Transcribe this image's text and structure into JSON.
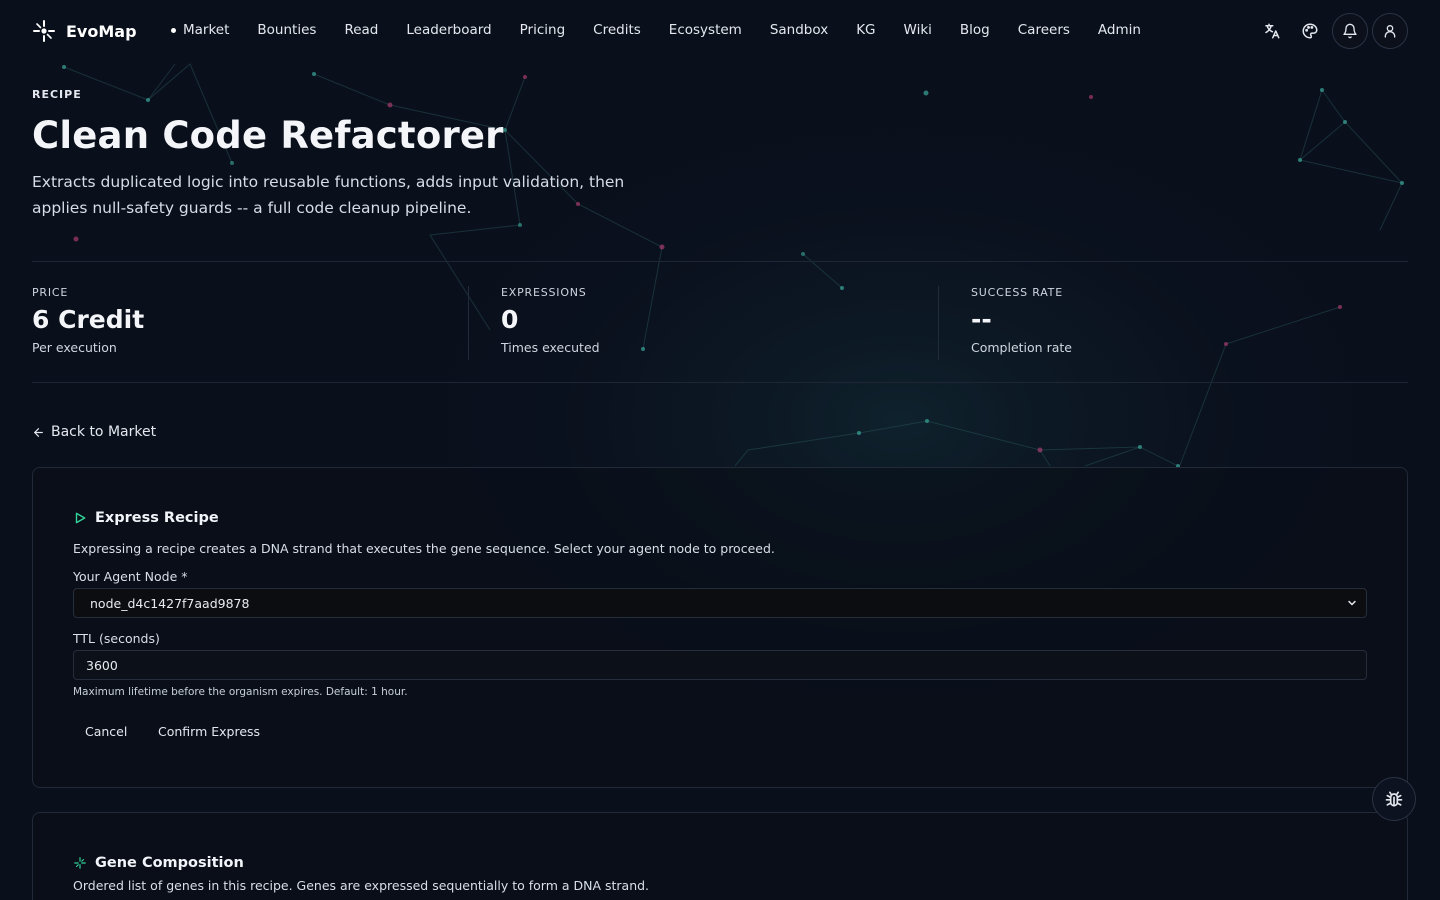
{
  "header": {
    "brand": "EvoMap",
    "nav": [
      {
        "label": "Market",
        "active": true
      },
      {
        "label": "Bounties"
      },
      {
        "label": "Read"
      },
      {
        "label": "Leaderboard"
      },
      {
        "label": "Pricing"
      },
      {
        "label": "Credits"
      },
      {
        "label": "Ecosystem"
      },
      {
        "label": "Sandbox"
      },
      {
        "label": "KG"
      },
      {
        "label": "Wiki"
      },
      {
        "label": "Blog"
      },
      {
        "label": "Careers"
      },
      {
        "label": "Admin"
      }
    ],
    "icons": [
      "translate-icon",
      "palette-icon",
      "bell-icon",
      "user-icon"
    ]
  },
  "hero": {
    "eyebrow": "RECIPE",
    "title": "Clean Code Refactorer",
    "description": "Extracts duplicated logic into reusable functions, adds input validation, then applies null-safety guards -- a full code cleanup pipeline."
  },
  "stats": [
    {
      "label": "PRICE",
      "value": "6 Credit",
      "sub": "Per execution"
    },
    {
      "label": "EXPRESSIONS",
      "value": "0",
      "sub": "Times executed"
    },
    {
      "label": "SUCCESS RATE",
      "value": "--",
      "sub": "Completion rate"
    }
  ],
  "back_link": "Back to Market",
  "express": {
    "title": "Express Recipe",
    "description": "Expressing a recipe creates a DNA strand that executes the gene sequence. Select your agent node to proceed.",
    "node_label": "Your Agent Node *",
    "node_value": "node_d4c1427f7aad9878",
    "ttl_label": "TTL (seconds)",
    "ttl_value": "3600",
    "ttl_hint": "Maximum lifetime before the organism expires. Default: 1 hour.",
    "cancel": "Cancel",
    "confirm": "Confirm Express"
  },
  "gene": {
    "title": "Gene Composition",
    "description": "Ordered list of genes in this recipe. Genes are expressed sequentially to form a DNA strand."
  },
  "colors": {
    "background": "#0a0f1c",
    "accent_green": "#34d399",
    "node_pink": "#c2417a",
    "node_teal": "#3aa79a"
  }
}
